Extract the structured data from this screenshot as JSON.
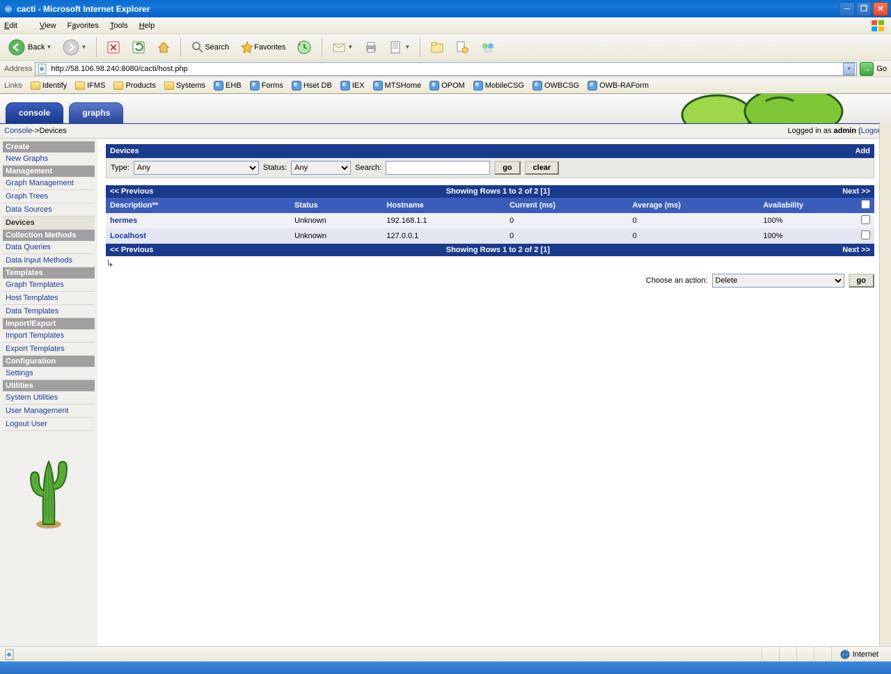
{
  "window": {
    "title": "cacti - Microsoft Internet Explorer"
  },
  "menubar": {
    "edit": "Edit",
    "view": "View",
    "favorites": "Favorites",
    "tools": "Tools",
    "help": "Help"
  },
  "toolbar": {
    "back": "Back",
    "search": "Search",
    "favorites": "Favorites"
  },
  "addressbar": {
    "label": "Address",
    "url": "http://58.106.98.240:8080/cacti/host.php",
    "go": "Go"
  },
  "linksbar": {
    "label": "Links",
    "folders": [
      "Identify",
      "IFMS",
      "Products",
      "Systems"
    ],
    "webs": [
      "EHB",
      "Forms",
      "Hset DB",
      "IEX",
      "MTSHome",
      "OPOM",
      "MobileCSG",
      "OWBCSG",
      "OWB-RAForm"
    ]
  },
  "tabs": {
    "console": "console",
    "graphs": "graphs"
  },
  "breadcrumb": {
    "root": "Console",
    "sep": " -> ",
    "current": "Devices",
    "logged": "Logged in as ",
    "user": "admin",
    "logout_open": " (",
    "logout": "Logout",
    "logout_close": ")"
  },
  "sidebar": {
    "create": {
      "h": "Create",
      "items": [
        "New Graphs"
      ]
    },
    "management": {
      "h": "Management",
      "items": [
        "Graph Management",
        "Graph Trees",
        "Data Sources",
        "Devices"
      ]
    },
    "collection": {
      "h": "Collection Methods",
      "items": [
        "Data Queries",
        "Data Input Methods"
      ]
    },
    "templates": {
      "h": "Templates",
      "items": [
        "Graph Templates",
        "Host Templates",
        "Data Templates"
      ]
    },
    "importexport": {
      "h": "Import/Export",
      "items": [
        "Import Templates",
        "Export Templates"
      ]
    },
    "configuration": {
      "h": "Configuration",
      "items": [
        "Settings"
      ]
    },
    "utilities": {
      "h": "Utilities",
      "items": [
        "System Utilities",
        "User Management",
        "Logout User"
      ]
    }
  },
  "panel": {
    "title": "Devices",
    "add": "Add"
  },
  "filter": {
    "type_label": "Type:",
    "type_value": "Any",
    "status_label": "Status:",
    "status_value": "Any",
    "search_label": "Search:",
    "search_value": "",
    "go": "go",
    "clear": "clear"
  },
  "pager": {
    "prev": "<< Previous",
    "showing": "Showing Rows 1 to 2 of 2 [",
    "page": "1",
    "closing": "]",
    "next": "Next >>"
  },
  "columns": {
    "description": "Description**",
    "status": "Status",
    "hostname": "Hostname",
    "current": "Current (ms)",
    "average": "Average (ms)",
    "availability": "Availability"
  },
  "rows": [
    {
      "description": "hermes",
      "status": "Unknown",
      "hostname": "192.168.1.1",
      "current": "0",
      "average": "0",
      "availability": "100%"
    },
    {
      "description": "Localhost",
      "status": "Unknown",
      "hostname": "127.0.0.1",
      "current": "0",
      "average": "0",
      "availability": "100%"
    }
  ],
  "action": {
    "label": "Choose an action:",
    "value": "Delete",
    "go": "go"
  },
  "statusbar": {
    "zone": "Internet"
  }
}
